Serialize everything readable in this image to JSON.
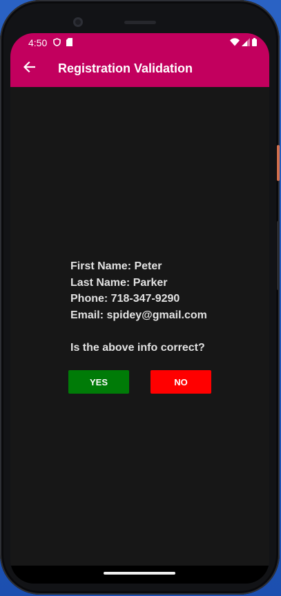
{
  "status_bar": {
    "time": "4:50",
    "left_icons": [
      "shield-icon",
      "sim-card-icon"
    ],
    "right_icons": [
      "wifi-icon",
      "cell-signal-icon",
      "battery-icon"
    ]
  },
  "app_bar": {
    "title": "Registration Validation",
    "back_icon": "arrow-back-icon"
  },
  "info": {
    "first_name": "First Name: Peter",
    "last_name": "Last Name: Parker",
    "phone": "Phone: 718-347-9290",
    "email": "Email: spidey@gmail.com",
    "question": "Is the above info correct?"
  },
  "buttons": {
    "yes_label": "YES",
    "no_label": "NO"
  },
  "colors": {
    "app_bar": "#c2005e",
    "background": "#171717",
    "yes_button": "#007b07",
    "no_button": "#ff0000",
    "text": "#e2e2e2"
  }
}
